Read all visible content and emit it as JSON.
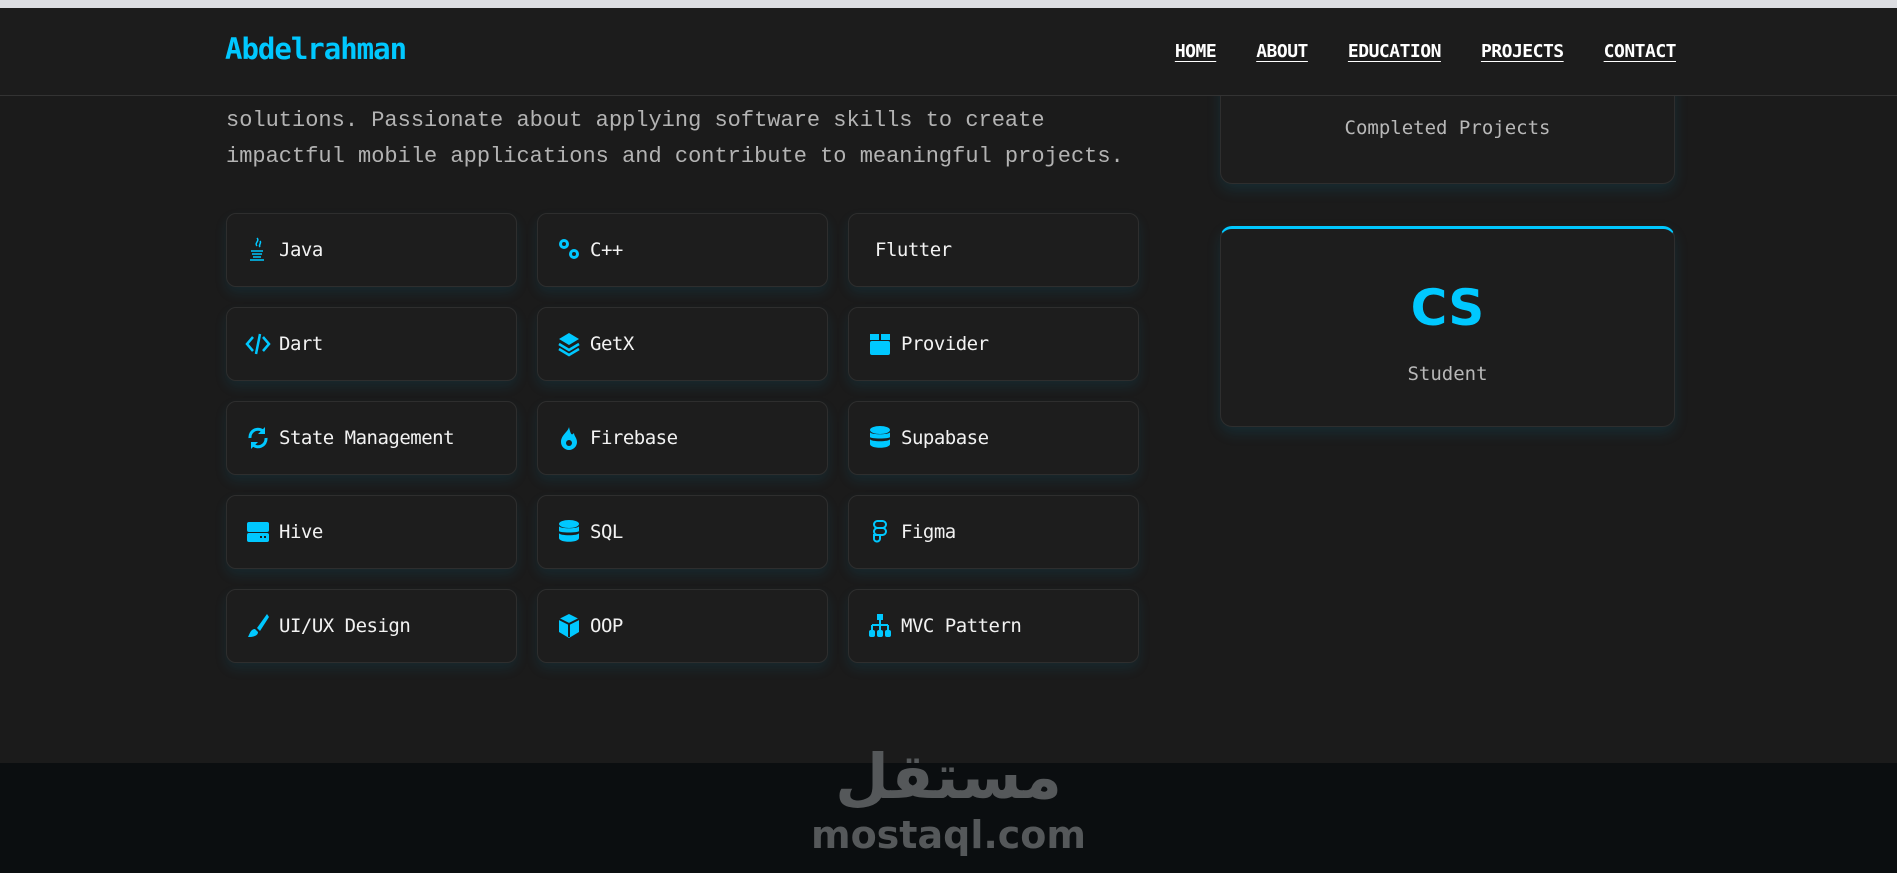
{
  "header": {
    "logo": "Abdelrahman",
    "nav": [
      "HOME",
      "ABOUT",
      "EDUCATION",
      "PROJECTS",
      "CONTACT"
    ]
  },
  "intro": {
    "lines": [
      "solutions. Passionate about applying software skills to create",
      "impactful mobile applications and contribute to meaningful projects."
    ]
  },
  "skills": [
    {
      "label": "Java",
      "icon": "java-icon"
    },
    {
      "label": "C++",
      "icon": "gears-icon"
    },
    {
      "label": "Flutter",
      "icon": "none"
    },
    {
      "label": "Dart",
      "icon": "code-icon"
    },
    {
      "label": "GetX",
      "icon": "layers-icon"
    },
    {
      "label": "Provider",
      "icon": "box-icon"
    },
    {
      "label": "State Management",
      "icon": "sync-icon"
    },
    {
      "label": "Firebase",
      "icon": "fire-icon"
    },
    {
      "label": "Supabase",
      "icon": "database-icon"
    },
    {
      "label": "Hive",
      "icon": "hdd-icon"
    },
    {
      "label": "SQL",
      "icon": "database-icon"
    },
    {
      "label": "Figma",
      "icon": "figma-icon"
    },
    {
      "label": "UI/UX Design",
      "icon": "brush-icon"
    },
    {
      "label": "OOP",
      "icon": "cube-icon"
    },
    {
      "label": "MVC Pattern",
      "icon": "sitemap-icon"
    }
  ],
  "stats": [
    {
      "label": "Completed Projects"
    },
    {
      "value": "CS",
      "label": "Student"
    }
  ],
  "watermark": {
    "arabic": "مستقل",
    "latin": "mostaql.com"
  },
  "colors": {
    "accent": "#00c8ff",
    "background": "#1b1b1b"
  }
}
